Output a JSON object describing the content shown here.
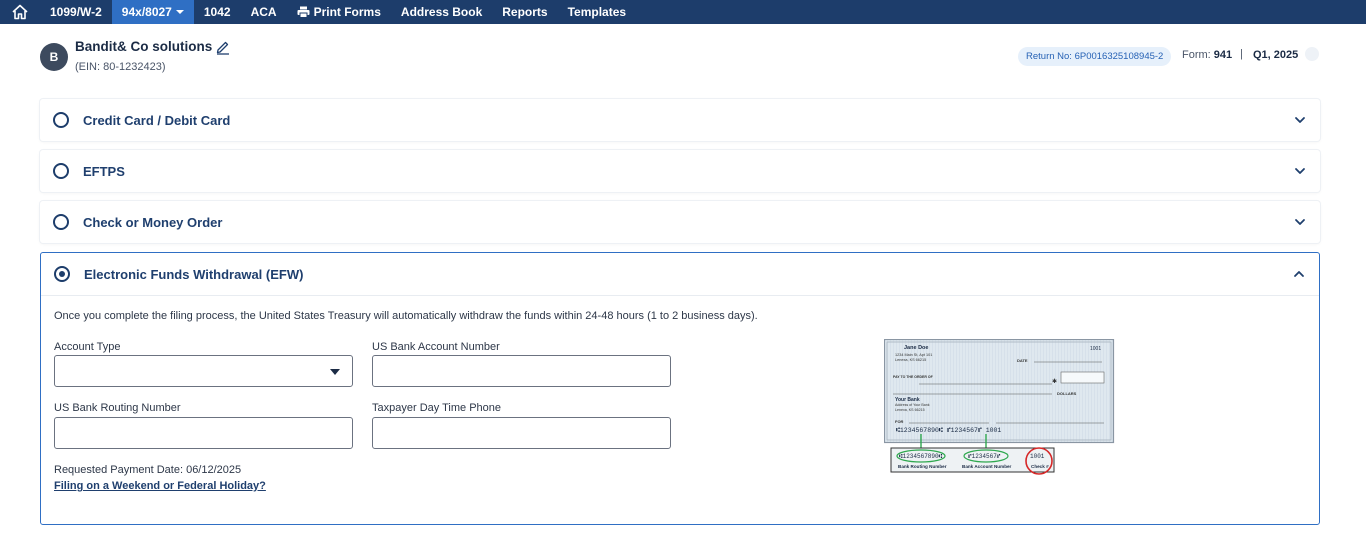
{
  "nav": {
    "items": [
      "1099/W-2",
      "94x/8027",
      "1042",
      "ACA",
      "Print Forms",
      "Address Book",
      "Reports",
      "Templates"
    ],
    "active_index": 1
  },
  "company": {
    "avatar_letter": "B",
    "name": "Bandit& Co solutions",
    "ein": "(EIN: 80-1232423)"
  },
  "return_info": {
    "return_no": "Return No: 6P0016325108945-2",
    "form_label": "Form:",
    "form_value": "941",
    "separator": "|",
    "quarter": "Q1, 2025"
  },
  "payment_options": {
    "credit_card": "Credit Card / Debit Card",
    "eftps": "EFTPS",
    "check": "Check or Money Order",
    "efw": "Electronic Funds Withdrawal (EFW)"
  },
  "selected_option": "efw",
  "efw": {
    "description": "Once you complete the filing process, the United States Treasury will automatically withdraw the funds within 24-48 hours (1 to 2 business days).",
    "account_type_label": "Account Type",
    "account_type_value": "",
    "account_number_label": "US Bank Account Number",
    "account_number_value": "",
    "routing_label": "US Bank Routing Number",
    "routing_value": "",
    "phone_label": "Taxpayer Day Time Phone",
    "phone_value": "",
    "requested_date": "Requested Payment Date: 06/12/2025",
    "weekend_link": "Filing on a Weekend or Federal Holiday?"
  },
  "check_sample": {
    "name": "Jane Doe",
    "address1": "1234 Main St, Apt 101",
    "address2": "Lenexa, KS 66215",
    "number": "1001",
    "date": "DATE",
    "pay_to": "PAY TO THE ORDER OF",
    "dollars": "DOLLARS",
    "bank": "Your Bank",
    "bank_addr1": "Address of Your Bank",
    "bank_addr2": "Lenexa, KS 66215",
    "for": "FOR",
    "micr": "⑆1234567890⑆   ⑈1234567⑈   1001",
    "callout_routing_digits": "⑆1234567890⑆",
    "callout_account_digits": "⑈1234567⑈",
    "callout_check_digits": "1001",
    "routing_caption": "Bank Routing Number",
    "account_caption": "Bank Account Number",
    "check_caption": "Check #"
  },
  "colors": {
    "nav_bg": "#1d3d6b",
    "nav_active": "#2f6fc4",
    "accent_border": "#2f6fc4",
    "title_text": "#1f3f6e"
  }
}
